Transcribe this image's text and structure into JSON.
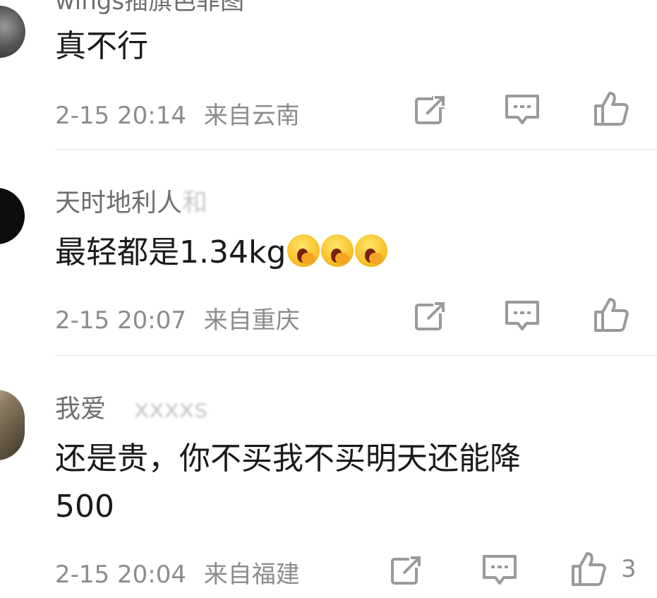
{
  "comments": [
    {
      "username": "wings插旗芭菲图",
      "text": "真不行",
      "time": "2-15 20:14",
      "location": "来自云南",
      "likes": ""
    },
    {
      "username": "天时地利人",
      "username_obscured": "和",
      "text": "最轻都是1.34kg",
      "time": "2-15 20:07",
      "location": "来自重庆",
      "likes": ""
    },
    {
      "username": "我爱",
      "username_obscured": "xxxxs",
      "text_line1": "还是贵，你不买我不买明天还能降",
      "text_line2": "500",
      "time": "2-15 20:04",
      "location": "来自福建",
      "likes": "3"
    }
  ],
  "icons": {
    "share": "share-icon",
    "comment": "comment-icon",
    "like": "thumbs-up-icon",
    "emoji": "yawn-emoji-icon"
  },
  "colors": {
    "username": "#6e6e6e",
    "text": "#1a1a1a",
    "meta": "#8c8c8c",
    "divider": "#e4e4e4",
    "badge": "#8ab8ee"
  }
}
